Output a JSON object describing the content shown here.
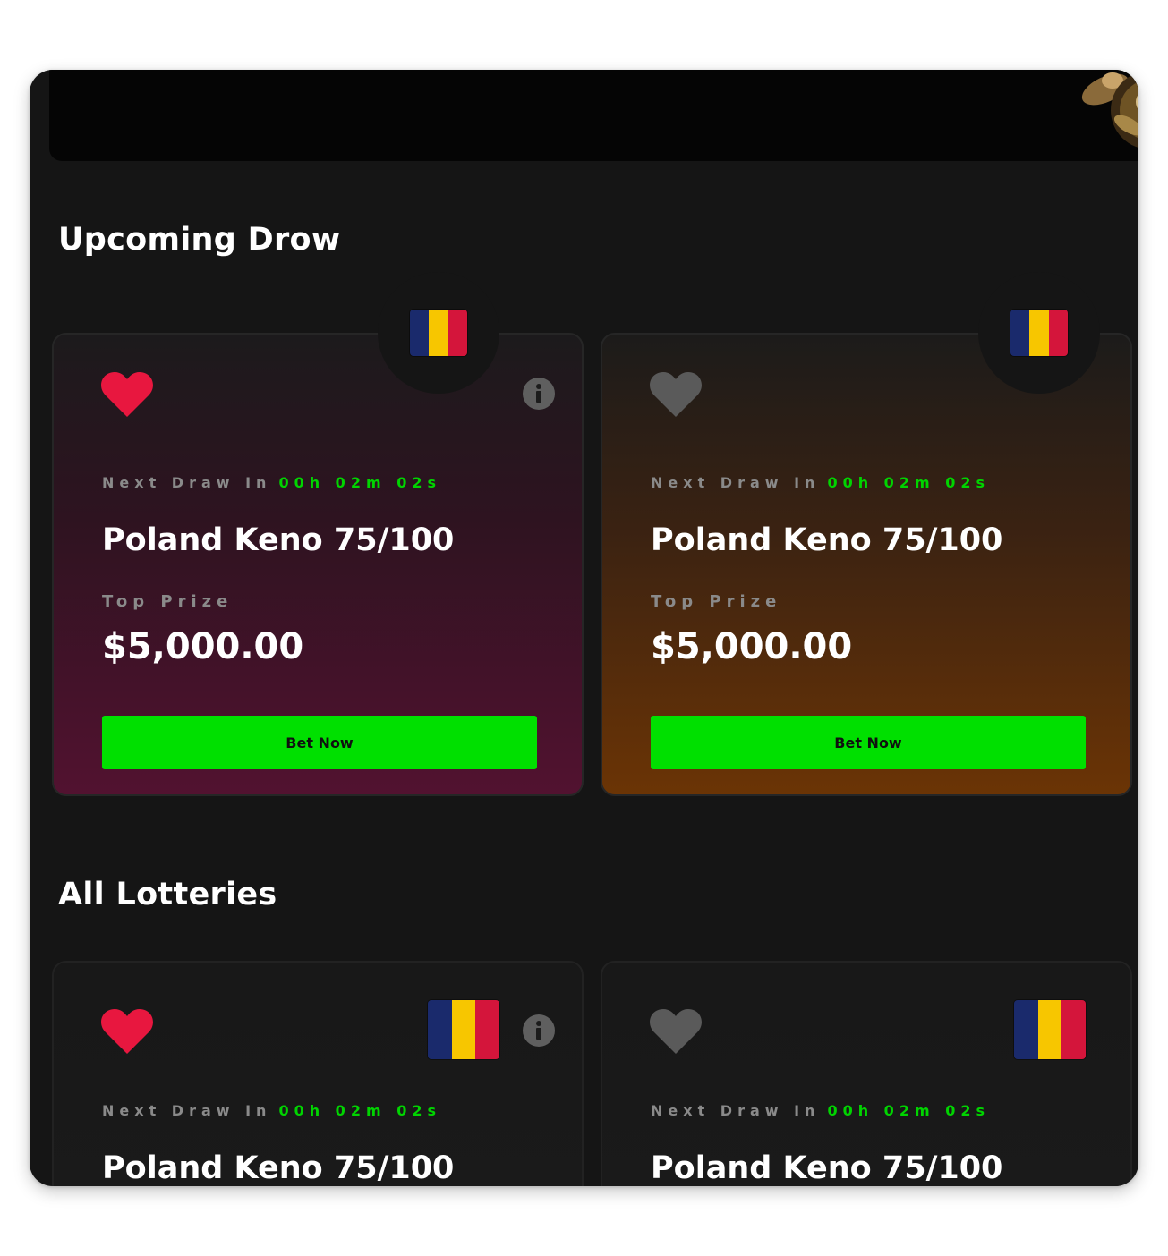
{
  "sections": {
    "upcoming_title": "Upcoming Drow",
    "all_title": "All Lotteries"
  },
  "cards": [
    {
      "next_draw_label": "Next Draw In",
      "timer": "00h 02m 02s",
      "name": "Poland Keno 75/100",
      "prize_label": "Top Prize",
      "prize": "$5,000.00",
      "button": "Bet Now",
      "favorite": true,
      "theme": "pink"
    },
    {
      "next_draw_label": "Next Draw In",
      "timer": "00h 02m 02s",
      "name": "Poland Keno 75/100",
      "prize_label": "Top Prize",
      "prize": "$5,000.00",
      "button": "Bet Now",
      "favorite": false,
      "theme": "orange"
    }
  ],
  "all_cards": [
    {
      "next_draw_label": "Next Draw In",
      "timer": "00h 02m 02s",
      "name": "Poland Keno 75/100",
      "favorite": true
    },
    {
      "next_draw_label": "Next Draw In",
      "timer": "00h 02m 02s",
      "name": "Poland Keno 75/100",
      "favorite": false
    }
  ],
  "colors": {
    "favorite_on": "#e8173f",
    "favorite_off": "#5a5a5a",
    "timer": "#00d400",
    "button": "#00e000"
  },
  "icons": {
    "favorite": "heart-icon",
    "info": "info-icon",
    "flag": "romania-flag-icon"
  }
}
